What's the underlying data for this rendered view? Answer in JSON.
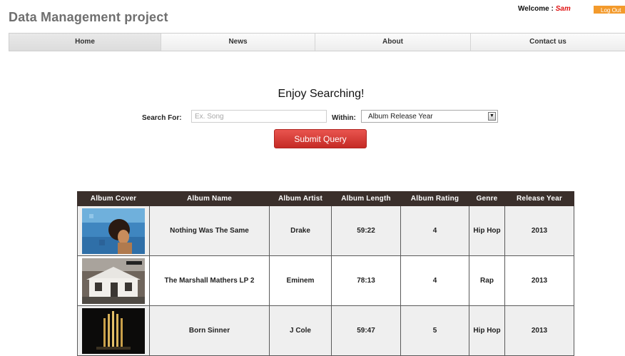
{
  "header": {
    "site_title": "Data Management project",
    "welcome_label": "Welcome : ",
    "username": "Sam",
    "logout_label": "Log Out"
  },
  "nav": {
    "items": [
      {
        "label": "Home",
        "active": true
      },
      {
        "label": "News",
        "active": false
      },
      {
        "label": "About",
        "active": false
      },
      {
        "label": "Contact us",
        "active": false
      }
    ]
  },
  "search": {
    "heading": "Enjoy Searching!",
    "search_label": "Search For:",
    "search_placeholder": "Ex. Song",
    "search_value": "",
    "within_label": "Within:",
    "within_selected": "Album Release Year",
    "submit_label": "Submit Query"
  },
  "table": {
    "headers": [
      "Album Cover",
      "Album Name",
      "Album Artist",
      "Album Length",
      "Album Rating",
      "Genre",
      "Release Year"
    ],
    "rows": [
      {
        "cover": "nothing-was-the-same-cover",
        "name": "Nothing Was The Same",
        "artist": "Drake",
        "length": "59:22",
        "rating": "4",
        "genre": "Hip Hop",
        "year": "2013"
      },
      {
        "cover": "marshall-mathers-lp2-cover",
        "name": "The Marshall Mathers LP 2",
        "artist": "Eminem",
        "length": "78:13",
        "rating": "4",
        "genre": "Rap",
        "year": "2013"
      },
      {
        "cover": "born-sinner-cover",
        "name": "Born Sinner",
        "artist": "J Cole",
        "length": "59:47",
        "rating": "5",
        "genre": "Hip Hop",
        "year": "2013"
      }
    ]
  },
  "colors": {
    "accent_red": "#e01010",
    "logout_orange": "#f39a2c",
    "submit_red": "#d83a34",
    "table_header_bg": "#3a2f2b"
  }
}
